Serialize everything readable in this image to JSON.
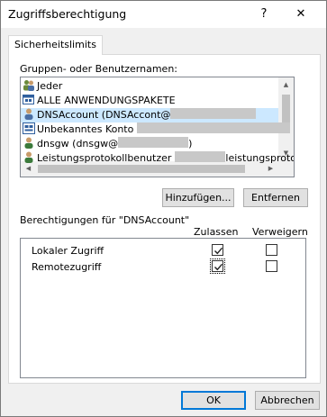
{
  "window": {
    "title": "Zugriffsberechtigung",
    "help_glyph": "?",
    "close_glyph": "✕"
  },
  "tab": {
    "label": "Sicherheitslimits"
  },
  "users": {
    "label": "Gruppen- oder Benutzernamen:",
    "items": [
      {
        "icon": "group-icon",
        "text": "Jeder"
      },
      {
        "icon": "package-group-icon",
        "text": "ALLE ANWENDUNGSPAKETE"
      },
      {
        "icon": "user-icon",
        "text": "DNSAccount (DNSAccont@"
      },
      {
        "icon": "unknown-account-icon",
        "text": "Unbekanntes Konto"
      },
      {
        "icon": "user-icon",
        "text": "dnsgw (dnsgw@",
        "suffix": ")"
      },
      {
        "icon": "user-icon",
        "text": "Leistungsprotokollbenutzer",
        "suffix": "leistungsprotokollber"
      }
    ],
    "selected_index": 2
  },
  "buttons": {
    "add": "Hinzufügen...",
    "remove": "Entfernen",
    "ok": "OK",
    "cancel": "Abbrechen"
  },
  "permissions": {
    "label": "Berechtigungen für \"DNSAccount\"",
    "col_allow": "Zulassen",
    "col_deny": "Verweigern",
    "rows": [
      {
        "name": "Lokaler Zugriff",
        "allow": true,
        "deny": false
      },
      {
        "name": "Remotezugriff",
        "allow": true,
        "deny": false
      }
    ]
  },
  "colors": {
    "selection": "#cce8ff",
    "default_button_border": "#0078d7"
  }
}
